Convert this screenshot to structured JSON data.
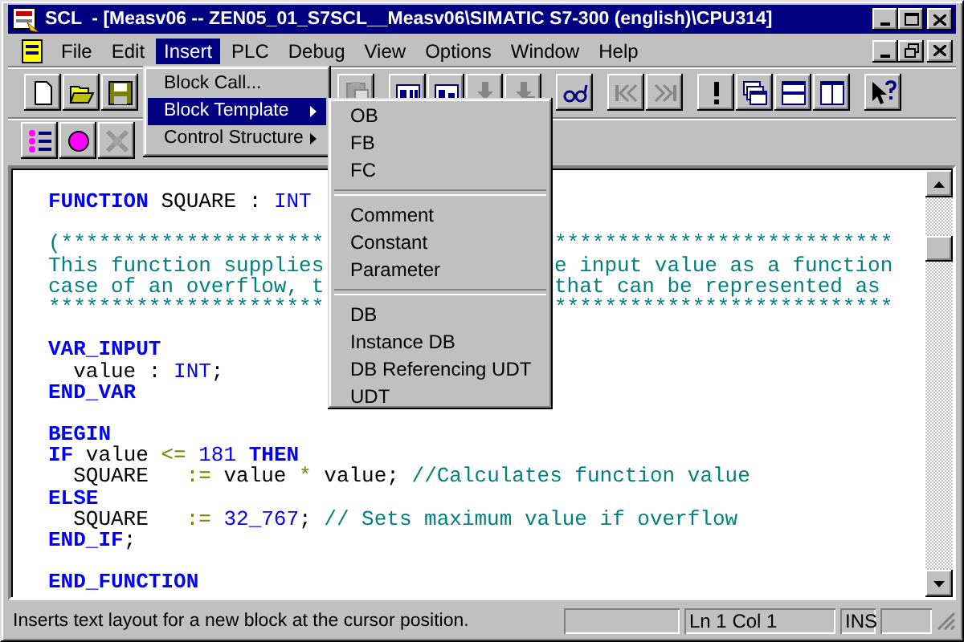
{
  "window": {
    "title": "SCL  - [Measv06 -- ZEN05_01_S7SCL__Measv06\\SIMATIC S7-300 (english)\\CPU314]"
  },
  "menu_bar": [
    {
      "label": "File",
      "selected": false
    },
    {
      "label": "Edit",
      "selected": false
    },
    {
      "label": "Insert",
      "selected": true
    },
    {
      "label": "PLC",
      "selected": false
    },
    {
      "label": "Debug",
      "selected": false
    },
    {
      "label": "View",
      "selected": false
    },
    {
      "label": "Options",
      "selected": false
    },
    {
      "label": "Window",
      "selected": false
    },
    {
      "label": "Help",
      "selected": false
    }
  ],
  "toolbar_1": [
    [
      {
        "kind": "new",
        "disabled": false
      },
      {
        "kind": "open",
        "disabled": false
      },
      {
        "kind": "save",
        "disabled": false
      }
    ],
    [
      {
        "kind": "paste",
        "disabled": true
      }
    ],
    [
      {
        "kind": "compile",
        "disabled": false
      },
      {
        "kind": "generate",
        "disabled": false
      },
      {
        "kind": "download",
        "disabled": true
      },
      {
        "kind": "upload",
        "disabled": true
      }
    ],
    [
      {
        "kind": "monitor",
        "disabled": false
      }
    ],
    [
      {
        "kind": "previous",
        "disabled": true
      },
      {
        "kind": "next",
        "disabled": true
      }
    ],
    [
      {
        "kind": "execute",
        "disabled": false
      },
      {
        "kind": "cascade",
        "disabled": false
      },
      {
        "kind": "tile_horizontal",
        "disabled": false
      },
      {
        "kind": "tile_vertical",
        "disabled": false
      }
    ],
    [
      {
        "kind": "help",
        "disabled": false
      }
    ]
  ],
  "toolbar_2": [
    {
      "kind": "list",
      "disabled": false
    },
    {
      "kind": "breakpoint",
      "disabled": false
    },
    {
      "kind": "clear_breakpoints",
      "disabled": true
    }
  ],
  "editor": {
    "lines": [
      {
        "kind": "code",
        "indented": false,
        "left": [
          {
            "kind": "kw",
            "text": "FUNCTION"
          },
          {
            "kind": "id",
            "text": " SQUARE : "
          },
          {
            "kind": "type",
            "text": "INT"
          }
        ]
      },
      {
        "kind": "blank"
      },
      {
        "kind": "code",
        "indented": false,
        "left": [
          {
            "kind": "cm",
            "text": "(*********************"
          }
        ],
        "right": [
          {
            "kind": "cm",
            "text": "***************************"
          }
        ]
      },
      {
        "kind": "code",
        "indented": false,
        "left": [
          {
            "kind": "cm",
            "text": "This function supplies"
          }
        ],
        "right": [
          {
            "kind": "cm",
            "text": "e input value as a function"
          }
        ]
      },
      {
        "kind": "code",
        "indented": false,
        "left": [
          {
            "kind": "cm",
            "text": "case of an overflow, t"
          }
        ],
        "right": [
          {
            "kind": "cm",
            "text": "that can be represented as"
          }
        ]
      },
      {
        "kind": "code",
        "indented": false,
        "left": [
          {
            "kind": "cm",
            "text": "**********************"
          }
        ],
        "right": [
          {
            "kind": "cm",
            "text": "***************************"
          }
        ]
      },
      {
        "kind": "blank"
      },
      {
        "kind": "code",
        "indented": false,
        "left": [
          {
            "kind": "kw",
            "text": "VAR_INPUT"
          }
        ]
      },
      {
        "kind": "code",
        "indented": true,
        "left": [
          {
            "kind": "id",
            "text": "value : "
          },
          {
            "kind": "type",
            "text": "INT"
          },
          {
            "kind": "id",
            "text": ";"
          }
        ]
      },
      {
        "kind": "code",
        "indented": false,
        "left": [
          {
            "kind": "kw",
            "text": "END_VAR"
          }
        ]
      },
      {
        "kind": "blank"
      },
      {
        "kind": "code",
        "indented": false,
        "left": [
          {
            "kind": "kw",
            "text": "BEGIN"
          }
        ]
      },
      {
        "kind": "code",
        "indented": false,
        "left": [
          {
            "kind": "kw",
            "text": "IF"
          },
          {
            "kind": "id",
            "text": " value "
          },
          {
            "kind": "op",
            "text": "<="
          },
          {
            "kind": "num",
            "text": " 181 "
          },
          {
            "kind": "kw",
            "text": "THEN"
          }
        ]
      },
      {
        "kind": "code",
        "indented": true,
        "left": [
          {
            "kind": "id",
            "text": "SQUARE   "
          },
          {
            "kind": "op",
            "text": ":="
          },
          {
            "kind": "id",
            "text": " value "
          },
          {
            "kind": "op",
            "text": "*"
          },
          {
            "kind": "id",
            "text": " value; "
          },
          {
            "kind": "cm",
            "text": "//Calculates function value"
          }
        ]
      },
      {
        "kind": "code",
        "indented": false,
        "left": [
          {
            "kind": "kw",
            "text": "ELSE"
          }
        ]
      },
      {
        "kind": "code",
        "indented": true,
        "left": [
          {
            "kind": "id",
            "text": "SQUARE   "
          },
          {
            "kind": "op",
            "text": ":="
          },
          {
            "kind": "num",
            "text": " 32_767"
          },
          {
            "kind": "id",
            "text": "; "
          },
          {
            "kind": "cm",
            "text": "// Sets maximum value if overflow"
          }
        ]
      },
      {
        "kind": "code",
        "indented": false,
        "left": [
          {
            "kind": "kw",
            "text": "END_IF"
          },
          {
            "kind": "id",
            "text": ";"
          }
        ]
      },
      {
        "kind": "blank"
      },
      {
        "kind": "code",
        "indented": false,
        "left": [
          {
            "kind": "kw",
            "text": "END_FUNCTION"
          }
        ]
      }
    ]
  },
  "insert_menu": {
    "items": [
      {
        "label": "Block Call...",
        "selected": false,
        "submenu": false
      },
      {
        "label": "Block Template",
        "selected": true,
        "submenu": true
      },
      {
        "label": "Control Structure",
        "selected": false,
        "submenu": true
      }
    ]
  },
  "block_template_menu": {
    "items": [
      {
        "kind": "item",
        "label": "OB"
      },
      {
        "kind": "item",
        "label": "FB"
      },
      {
        "kind": "item",
        "label": "FC"
      },
      {
        "kind": "separator"
      },
      {
        "kind": "item",
        "label": "Comment"
      },
      {
        "kind": "item",
        "label": "Constant"
      },
      {
        "kind": "item",
        "label": "Parameter"
      },
      {
        "kind": "separator"
      },
      {
        "kind": "item",
        "label": "DB"
      },
      {
        "kind": "item",
        "label": "Instance DB"
      },
      {
        "kind": "item",
        "label": "DB Referencing UDT"
      },
      {
        "kind": "item",
        "label": "UDT"
      }
    ]
  },
  "status_bar": {
    "message": "Inserts text layout for a new block at the cursor position.",
    "position": "Ln 1 Col 1",
    "mode": "INS"
  }
}
